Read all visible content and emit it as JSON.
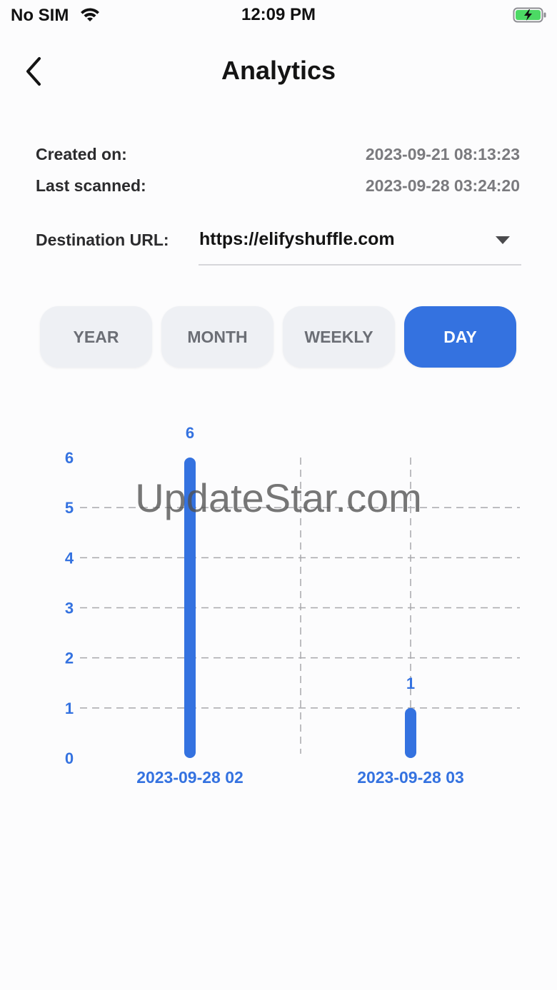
{
  "status_bar": {
    "carrier": "No SIM",
    "time": "12:09 PM",
    "wifi_icon": "wifi-icon",
    "battery_icon": "battery-charging-icon"
  },
  "header": {
    "back_icon": "chevron-left-icon",
    "title": "Analytics"
  },
  "info": {
    "created_label": "Created on:",
    "created_value": "2023-09-21 08:13:23",
    "scanned_label": "Last scanned:",
    "scanned_value": "2023-09-28 03:24:20",
    "destination_label": "Destination URL:",
    "destination_value": "https://elifyshuffle.com"
  },
  "tabs": [
    {
      "label": "YEAR",
      "active": false
    },
    {
      "label": "MONTH",
      "active": false
    },
    {
      "label": "WEEKLY",
      "active": false
    },
    {
      "label": "DAY",
      "active": true
    }
  ],
  "colors": {
    "accent": "#3472e0",
    "tab_bg": "#eef0f4",
    "axis_text": "#3472e0",
    "grid": "#a8a8ac"
  },
  "watermark": "UpdateStar.com",
  "chart_data": {
    "type": "bar",
    "categories": [
      "2023-09-28 02",
      "2023-09-28 03"
    ],
    "values": [
      6,
      1
    ],
    "data_labels": [
      "6",
      "1"
    ],
    "y_ticks": [
      "0",
      "1",
      "2",
      "3",
      "4",
      "5",
      "6"
    ],
    "ylim": [
      0,
      6
    ],
    "title": "",
    "xlabel": "",
    "ylabel": "",
    "grid": true
  }
}
